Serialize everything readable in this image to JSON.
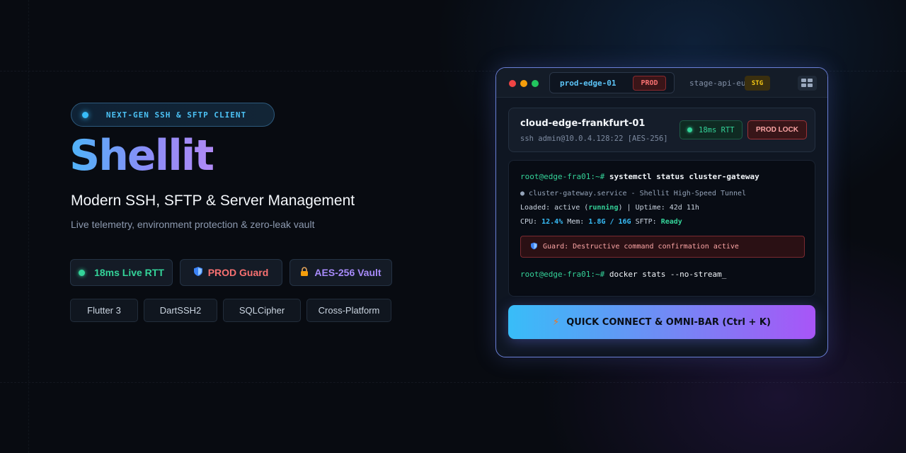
{
  "hero": {
    "badge": "NEXT-GEN SSH & SFTP CLIENT",
    "title": "Shellit",
    "subtitle": "Modern SSH, SFTP & Server Management",
    "tagline": "Live telemetry, environment protection & zero-leak vault"
  },
  "features": [
    {
      "label": "18ms Live RTT",
      "icon": "green-dot-icon",
      "color": "#34d399"
    },
    {
      "label": "PROD Guard",
      "icon": "shield-icon",
      "color": "#f87171"
    },
    {
      "label": "AES-256 Vault",
      "icon": "lock-icon",
      "color": "#a78bfa"
    }
  ],
  "tech": [
    "Flutter 3",
    "DartSSH2",
    "SQLCipher",
    "Cross-Platform"
  ],
  "window": {
    "tabs": [
      {
        "name": "prod-edge-01",
        "env": "PROD"
      },
      {
        "name": "stage-api-eu",
        "env": "STG"
      }
    ],
    "host": {
      "name": "cloud-edge-frankfurt-01",
      "command": "ssh admin@10.0.4.128:22 [AES-256]",
      "rtt": "18ms RTT",
      "lock": "PROD LOCK"
    },
    "terminal": {
      "prompt": "root@edge-fra01:~#",
      "cmd1": "systemctl status cluster-gateway",
      "service_line": "● cluster-gateway.service - Shellit High-Speed Tunnel",
      "loaded_prefix": "Loaded: active (",
      "loaded_state": "running",
      "loaded_suffix": ") | Uptime: 42d 11h",
      "cpu_label": "CPU: ",
      "cpu_value": "12.4%",
      "mem_label": " Mem: ",
      "mem_value": "1.8G / 16G",
      "sftp_label": " SFTP: ",
      "sftp_value": "Ready",
      "guard": "Guard: Destructive command confirmation active",
      "cmd2": "docker stats --no-stream_"
    },
    "cta": "QUICK CONNECT & OMNI-BAR (Ctrl + K)"
  },
  "colors": {
    "accent_blue": "#38bdf8",
    "accent_purple": "#a855f7",
    "prod_red": "#f87171",
    "stg_yellow": "#facc15",
    "ok_green": "#34d399"
  }
}
